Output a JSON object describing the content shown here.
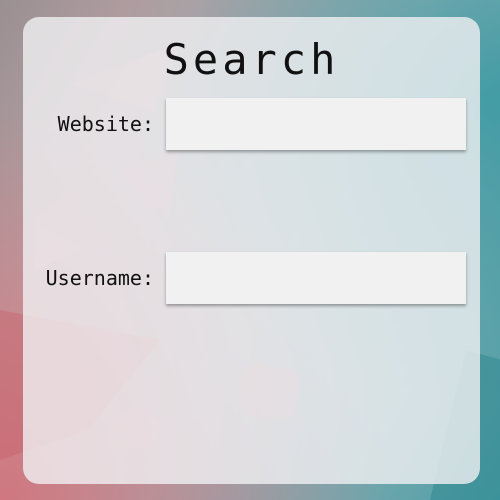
{
  "form": {
    "title": "Search",
    "website": {
      "label": "Website:",
      "value": "",
      "placeholder": ""
    },
    "username": {
      "label": "Username:",
      "value": "",
      "placeholder": ""
    }
  },
  "colors": {
    "card": "#f0f0f2",
    "field": "#f1f1f1",
    "accent_teal": "#4e9ea6",
    "accent_pink": "#d66e78"
  }
}
